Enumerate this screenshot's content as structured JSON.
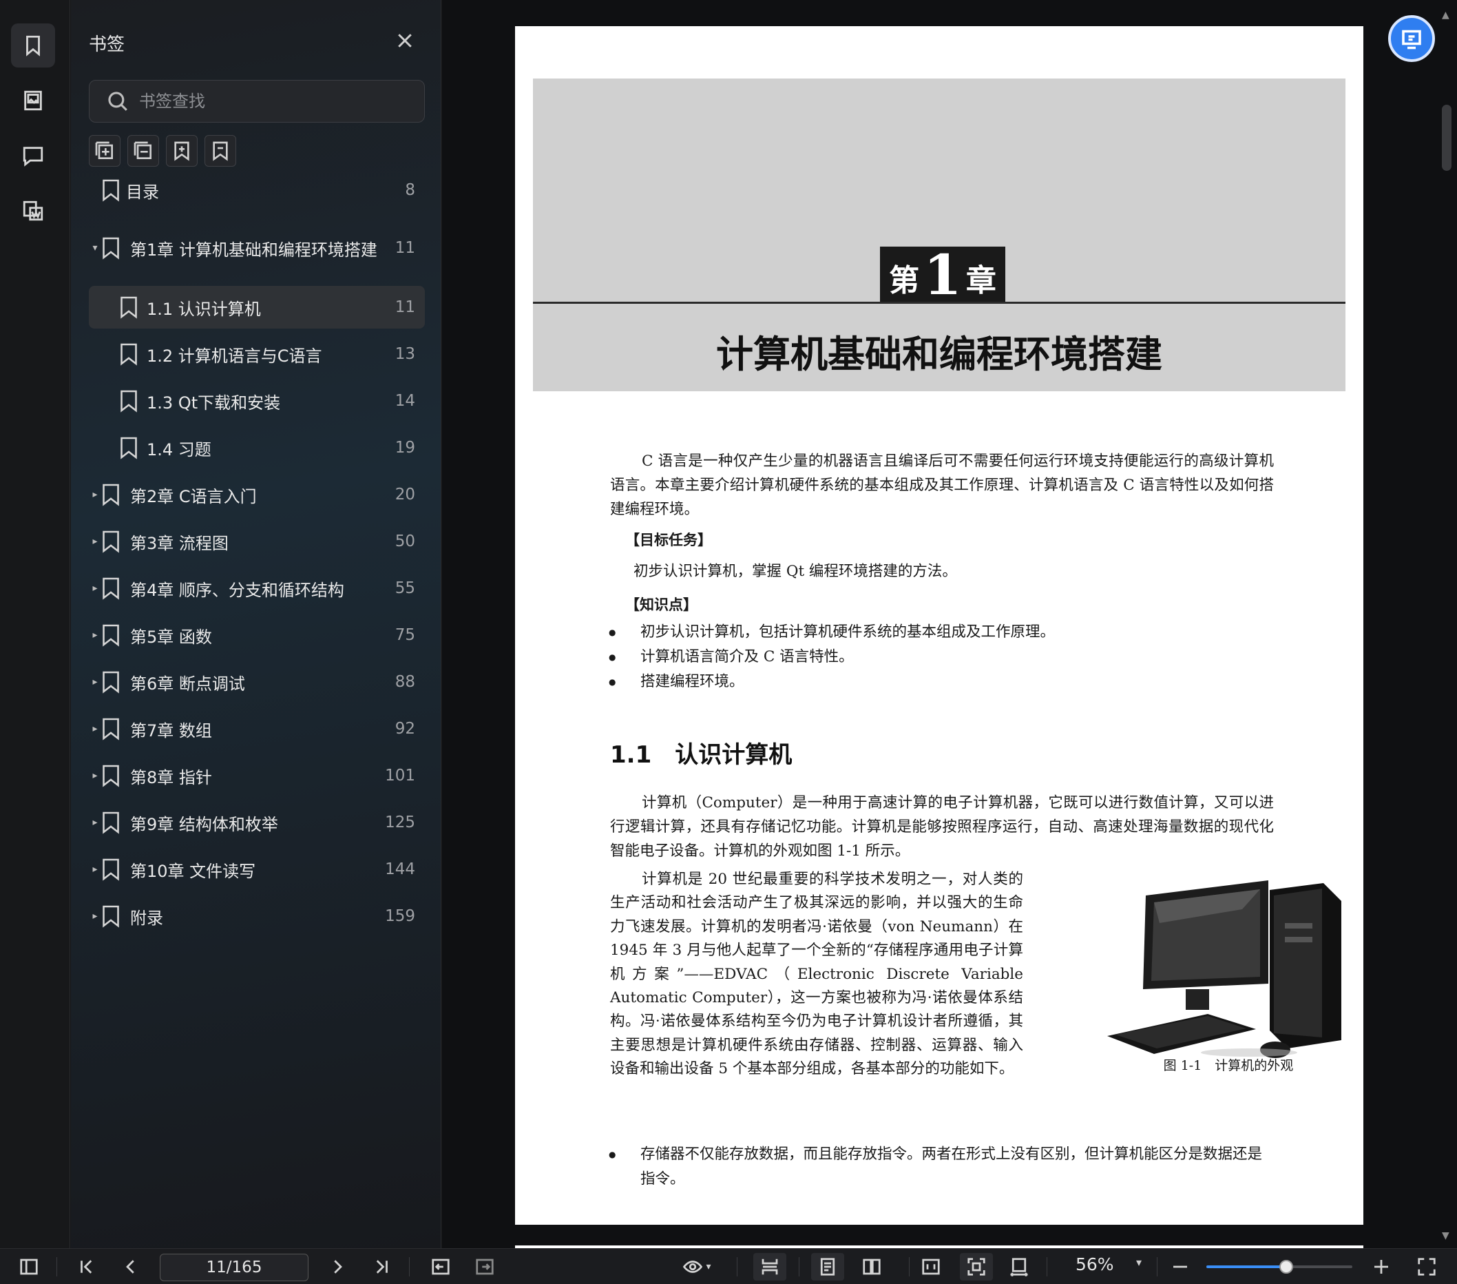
{
  "panel": {
    "title": "书签",
    "search_placeholder": "书签查找"
  },
  "bookmarks": [
    {
      "label": "目录",
      "page": "8",
      "level": 0,
      "expand": "none"
    },
    {
      "label": "第1章 计算机基础和编程环境搭建",
      "page": "11",
      "level": 0,
      "expand": "open"
    },
    {
      "label": "1.1 认识计算机",
      "page": "11",
      "level": 1,
      "expand": "none",
      "selected": true
    },
    {
      "label": "1.2 计算机语言与C语言",
      "page": "13",
      "level": 1,
      "expand": "none"
    },
    {
      "label": "1.3 Qt下载和安装",
      "page": "14",
      "level": 1,
      "expand": "none"
    },
    {
      "label": "1.4 习题",
      "page": "19",
      "level": 1,
      "expand": "none"
    },
    {
      "label": "第2章 C语言入门",
      "page": "20",
      "level": 0,
      "expand": "closed"
    },
    {
      "label": "第3章 流程图",
      "page": "50",
      "level": 0,
      "expand": "closed"
    },
    {
      "label": "第4章 顺序、分支和循环结构",
      "page": "55",
      "level": 0,
      "expand": "closed"
    },
    {
      "label": "第5章 函数",
      "page": "75",
      "level": 0,
      "expand": "closed"
    },
    {
      "label": "第6章 断点调试",
      "page": "88",
      "level": 0,
      "expand": "closed"
    },
    {
      "label": "第7章 数组",
      "page": "92",
      "level": 0,
      "expand": "closed"
    },
    {
      "label": "第8章 指针",
      "page": "101",
      "level": 0,
      "expand": "closed"
    },
    {
      "label": "第9章 结构体和枚举",
      "page": "125",
      "level": 0,
      "expand": "closed"
    },
    {
      "label": "第10章 文件读写",
      "page": "144",
      "level": 0,
      "expand": "closed"
    },
    {
      "label": "附录",
      "page": "159",
      "level": 0,
      "expand": "closed"
    }
  ],
  "doc": {
    "chapter_prefix": "第",
    "chapter_num": "1",
    "chapter_suffix": "章",
    "chapter_title": "计算机基础和编程环境搭建",
    "intro": "C 语言是一种仅产生少量的机器语言且编译后可不需要任何运行环境支持便能运行的高级计算机语言。本章主要介绍计算机硬件系统的基本组成及其工作原理、计算机语言及 C 语言特性以及如何搭建编程环境。",
    "goal_head": "【目标任务】",
    "goal_text": "初步认识计算机，掌握 Qt 编程环境搭建的方法。",
    "kp_head": "【知识点】",
    "kp_items": [
      "初步认识计算机，包括计算机硬件系统的基本组成及工作原理。",
      "计算机语言简介及 C 语言特性。",
      "搭建编程环境。"
    ],
    "section_num": "1.1",
    "section_title": "认识计算机",
    "para1": "计算机（Computer）是一种用于高速计算的电子计算机器，它既可以进行数值计算，又可以进行逻辑计算，还具有存储记忆功能。计算机是能够按照程序运行，自动、高速处理海量数据的现代化智能电子设备。计算机的外观如图 1-1 所示。",
    "para2": "计算机是 20 世纪最重要的科学技术发明之一，对人类的生产活动和社会活动产生了极其深远的影响，并以强大的生命力飞速发展。计算机的发明者冯·诺依曼（von Neumann）在 1945 年 3 月与他人起草了一个全新的“存储程序通用电子计算机方案”——EDVAC（Electronic Discrete Variable Automatic Computer），这一方案也被称为冯·诺依曼体系结构。冯·诺依曼体系结构至今仍为电子计算机设计者所遵循，其主要思想是计算机硬件系统由存储器、控制器、运算器、输入设备和输出设备 5 个基本部分组成，各基本部分的功能如下。",
    "figure_caption": "图 1-1　计算机的外观",
    "bullet2": "存储器不仅能存放数据，而且能存放指令。两者在形式上没有区别，但计算机能区分是数据还是指令。"
  },
  "toolbar": {
    "page_indicator": "11/165",
    "zoom": "56%",
    "zoom_level_percent": 56
  },
  "colors": {
    "accent": "#3a8ef6",
    "float_button": "#2f7ef0",
    "selected_row": "#2f3236"
  }
}
